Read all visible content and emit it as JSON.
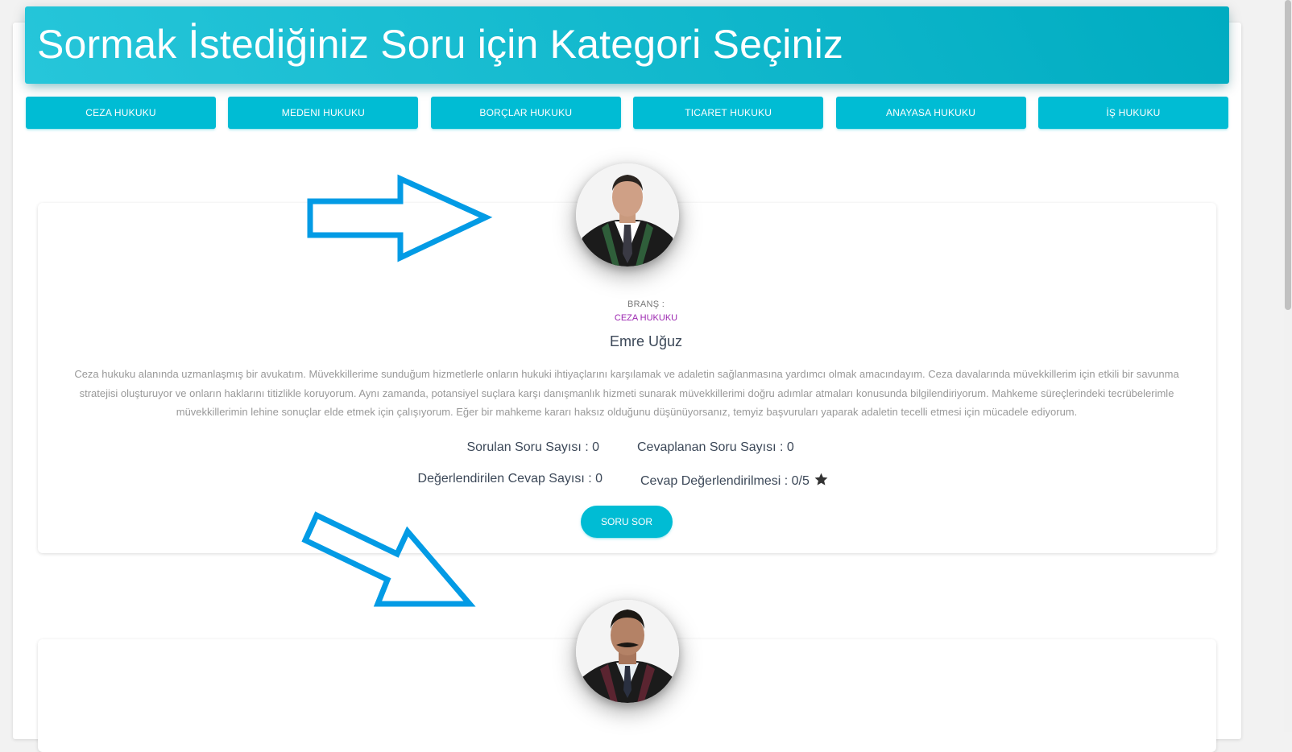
{
  "header": {
    "title": "Sormak İstediğiniz Soru için Kategori Seçiniz"
  },
  "categories": [
    {
      "label": "CEZA HUKUKU"
    },
    {
      "label": "MEDENI HUKUKU"
    },
    {
      "label": "BORÇLAR HUKUKU"
    },
    {
      "label": "TICARET HUKUKU"
    },
    {
      "label": "ANAYASA HUKUKU"
    },
    {
      "label": "İŞ HUKUKU"
    }
  ],
  "lawyer": {
    "brans_label": "BRANŞ :",
    "brans_value": "CEZA HUKUKU",
    "name": "Emre Uğuz",
    "bio": "Ceza hukuku alanında uzmanlaşmış bir avukatım. Müvekkillerime sunduğum hizmetlerle onların hukuki ihtiyaçlarını karşılamak ve adaletin sağlanmasına yardımcı olmak amacındayım. Ceza davalarında müvekkillerim için etkili bir savunma stratejisi oluşturuyor ve onların haklarını titizlikle koruyorum. Aynı zamanda, potansiyel suçlara karşı danışmanlık hizmeti sunarak müvekkillerimi doğru adımlar atmaları konusunda bilgilendiriyorum. Mahkeme süreçlerindeki tecrübelerimle müvekkillerimin lehine sonuçlar elde etmek için çalışıyorum. Eğer bir mahkeme kararı haksız olduğunu düşünüyorsanız, temyiz başvuruları yaparak adaletin tecelli etmesi için mücadele ediyorum.",
    "stats": {
      "asked": "Sorulan Soru Sayısı : 0",
      "answered": "Cevaplanan Soru Sayısı : 0",
      "rated": "Değerlendirilen Cevap Sayısı : 0",
      "rating": "Cevap Değerlendirilmesi : 0/5"
    },
    "ask_button": "SORU SOR"
  },
  "colors": {
    "primary": "#00bcd4",
    "brans": "#9c27b0",
    "arrow": "#039be5"
  },
  "icons": {
    "rating": "star-icon",
    "annotation": "arrow-icon"
  }
}
